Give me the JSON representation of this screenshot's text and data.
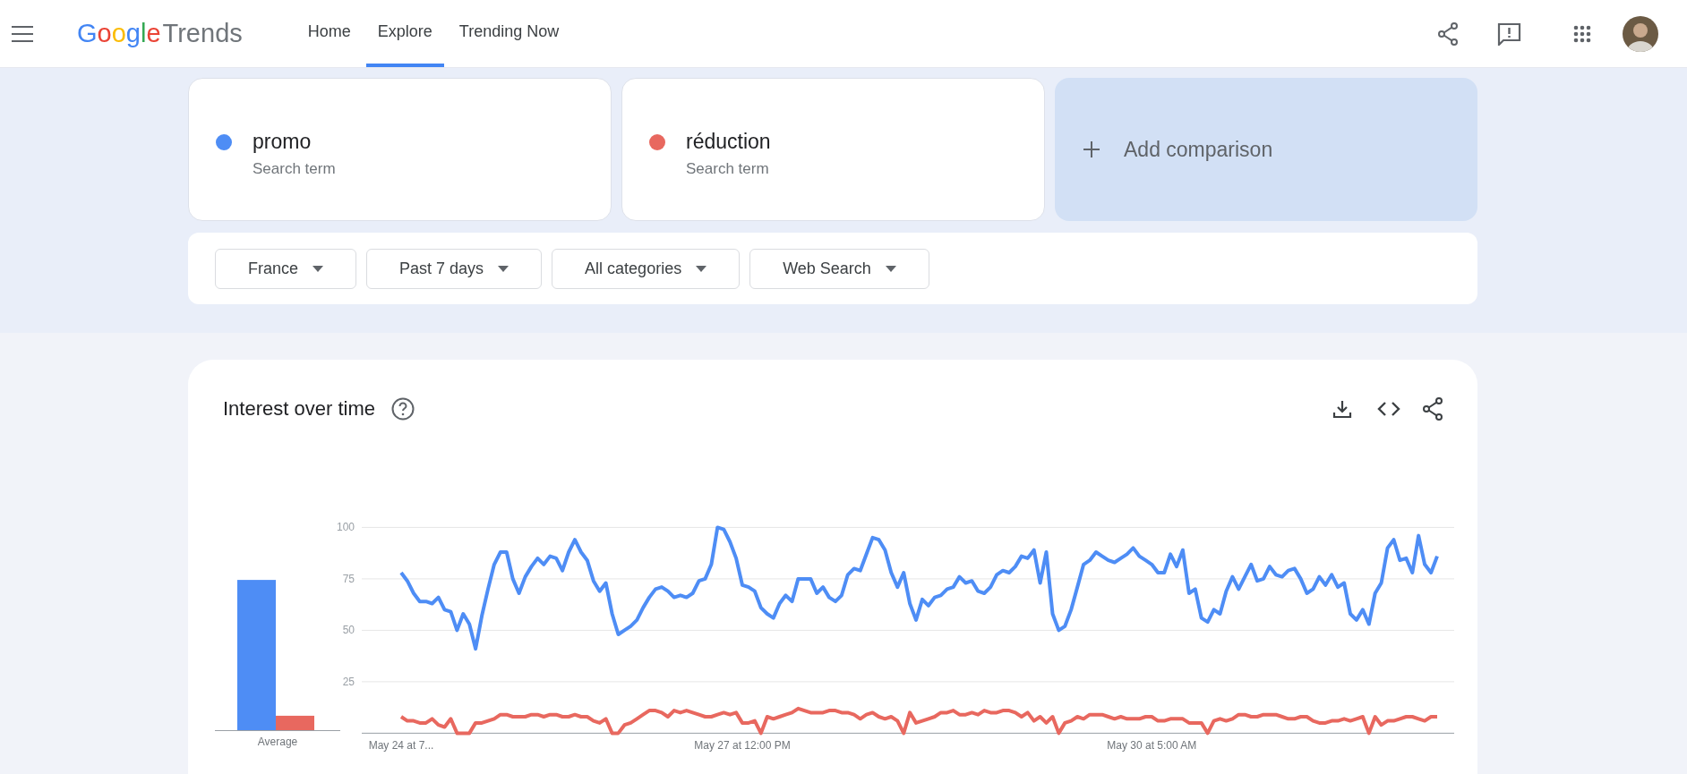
{
  "header": {
    "logo": {
      "brand": "Google",
      "product": "Trends"
    },
    "nav": [
      {
        "label": "Home",
        "selected": false
      },
      {
        "label": "Explore",
        "selected": true
      },
      {
        "label": "Trending Now",
        "selected": false
      }
    ]
  },
  "terms": [
    {
      "name": "promo",
      "subtitle": "Search term",
      "color": "#4e8df5"
    },
    {
      "name": "réduction",
      "subtitle": "Search term",
      "color": "#e8685f"
    }
  ],
  "add_comparison": "Add comparison",
  "filters": [
    {
      "label": "France"
    },
    {
      "label": "Past 7 days"
    },
    {
      "label": "All categories"
    },
    {
      "label": "Web Search"
    }
  ],
  "interest_over_time": {
    "title": "Interest over time",
    "average_label": "Average",
    "chart_data": {
      "type": "line",
      "grid": true,
      "ylim": [
        0,
        100
      ],
      "categories": [
        "May 24 at 7...",
        null,
        null,
        null,
        null,
        null,
        null,
        null,
        null,
        null,
        null,
        null,
        null,
        null,
        null,
        null,
        null,
        null,
        null,
        null,
        null,
        null,
        null,
        null,
        null,
        null,
        null,
        null,
        null,
        null,
        null,
        null,
        null,
        null,
        null,
        null,
        null,
        null,
        null,
        null,
        null,
        null,
        null,
        null,
        null,
        null,
        null,
        null,
        null,
        null,
        null,
        null,
        null,
        null,
        null,
        "May 27 at 12:00 PM",
        null,
        null,
        null,
        null,
        null,
        null,
        null,
        null,
        null,
        null,
        null,
        null,
        null,
        null,
        null,
        null,
        null,
        null,
        null,
        null,
        null,
        null,
        null,
        null,
        null,
        null,
        null,
        null,
        null,
        null,
        null,
        null,
        null,
        null,
        null,
        null,
        null,
        null,
        null,
        null,
        null,
        null,
        null,
        null,
        null,
        null,
        null,
        null,
        null,
        null,
        null,
        null,
        null,
        null,
        null,
        null,
        null,
        null,
        null,
        null,
        null,
        null,
        null,
        null,
        null,
        "May 30 at 5:00 AM",
        null,
        null,
        null,
        null,
        null,
        null,
        null,
        null,
        null,
        null,
        null,
        null,
        null,
        null,
        null,
        null,
        null,
        null,
        null,
        null,
        null,
        null,
        null,
        null,
        null,
        null,
        null,
        null,
        null,
        null,
        null,
        null,
        null,
        null,
        null,
        null,
        null,
        null,
        null,
        null,
        null,
        null,
        null,
        null,
        null,
        null
      ],
      "yticks": [
        25,
        50,
        75,
        100
      ],
      "series": [
        {
          "color": "#4e8df5",
          "values": [
            78,
            74,
            68,
            64,
            64,
            63,
            66,
            60,
            59,
            50,
            58,
            53,
            41,
            57,
            70,
            82,
            88,
            88,
            75,
            68,
            76,
            81,
            85,
            82,
            86,
            85,
            79,
            88,
            94,
            88,
            84,
            74,
            69,
            73,
            58,
            48,
            50,
            52,
            55,
            61,
            66,
            70,
            71,
            69,
            66,
            67,
            66,
            68,
            74,
            75,
            82,
            100,
            99,
            93,
            85,
            72,
            71,
            69,
            61,
            58,
            56,
            63,
            67,
            64,
            75,
            75,
            75,
            68,
            71,
            66,
            64,
            67,
            77,
            80,
            79,
            87,
            95,
            94,
            89,
            78,
            71,
            78,
            63,
            55,
            65,
            62,
            66,
            67,
            70,
            71,
            76,
            73,
            74,
            69,
            68,
            71,
            77,
            79,
            78,
            81,
            86,
            85,
            89,
            73,
            88,
            58,
            50,
            52,
            60,
            71,
            82,
            84,
            88,
            86,
            84,
            83,
            85,
            87,
            90,
            86,
            84,
            82,
            78,
            78,
            87,
            81,
            89,
            68,
            70,
            56,
            54,
            60,
            58,
            69,
            76,
            70,
            76,
            82,
            74,
            75,
            81,
            77,
            76,
            79,
            80,
            75,
            68,
            70,
            76,
            72,
            77,
            71,
            73,
            58,
            55,
            60,
            53,
            68,
            73,
            90,
            94,
            84,
            85,
            78,
            96,
            82,
            78,
            86
          ]
        },
        {
          "color": "#e8685f",
          "values": [
            8,
            6,
            6,
            5,
            5,
            7,
            4,
            3,
            7,
            0,
            0,
            0,
            5,
            5,
            6,
            7,
            9,
            9,
            8,
            8,
            8,
            9,
            9,
            8,
            9,
            9,
            8,
            8,
            9,
            8,
            8,
            6,
            5,
            7,
            0,
            0,
            4,
            5,
            7,
            9,
            11,
            11,
            10,
            8,
            11,
            10,
            11,
            10,
            9,
            8,
            8,
            9,
            10,
            9,
            10,
            5,
            5,
            6,
            0,
            8,
            7,
            8,
            9,
            10,
            12,
            11,
            10,
            10,
            10,
            11,
            11,
            10,
            10,
            9,
            7,
            9,
            10,
            8,
            7,
            8,
            6,
            0,
            10,
            5,
            6,
            7,
            8,
            10,
            10,
            11,
            9,
            9,
            10,
            9,
            11,
            10,
            10,
            11,
            11,
            10,
            8,
            10,
            6,
            8,
            5,
            8,
            0,
            5,
            6,
            8,
            7,
            9,
            9,
            9,
            8,
            7,
            8,
            7,
            7,
            7,
            8,
            8,
            6,
            6,
            7,
            7,
            7,
            5,
            5,
            5,
            0,
            6,
            7,
            6,
            7,
            9,
            9,
            8,
            8,
            9,
            9,
            9,
            8,
            7,
            7,
            8,
            8,
            6,
            5,
            5,
            6,
            6,
            7,
            6,
            7,
            8,
            0,
            8,
            4,
            6,
            6,
            7,
            8,
            8,
            7,
            6,
            8,
            8
          ]
        }
      ]
    }
  }
}
